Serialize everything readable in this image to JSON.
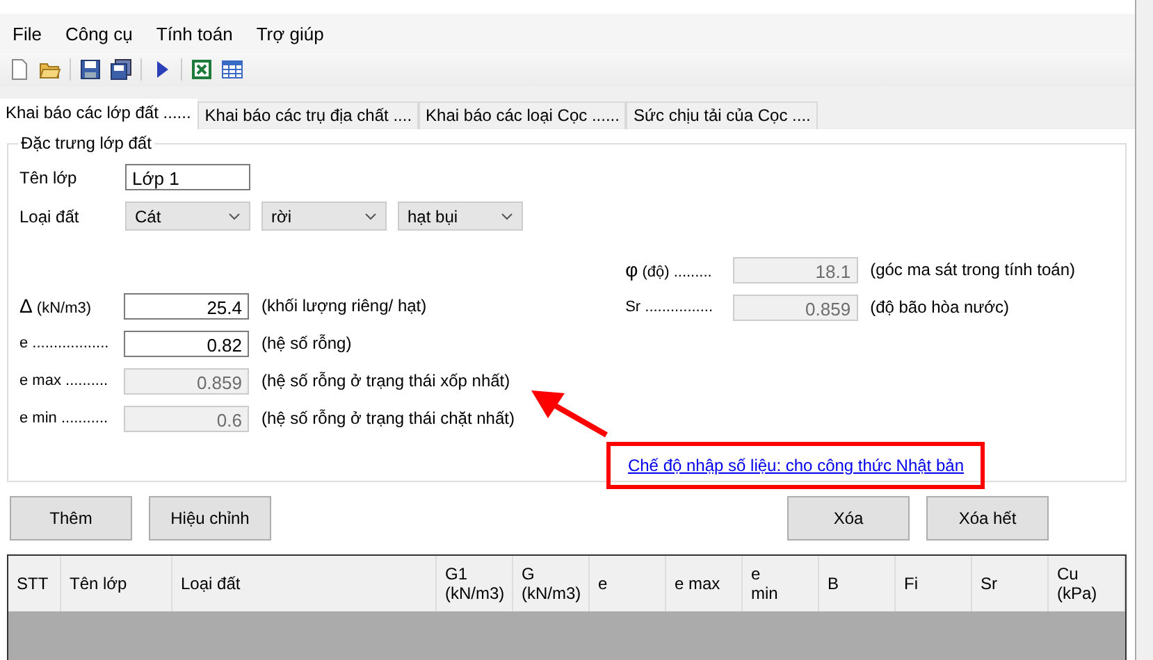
{
  "menu": [
    "File",
    "Công cụ",
    "Tính toán",
    "Trợ giúp"
  ],
  "toolbar": [
    {
      "kind": "new"
    },
    {
      "kind": "open"
    },
    {
      "kind": "sep"
    },
    {
      "kind": "save"
    },
    {
      "kind": "saveall"
    },
    {
      "kind": "sep"
    },
    {
      "kind": "run"
    },
    {
      "kind": "sep"
    },
    {
      "kind": "excel"
    },
    {
      "kind": "table"
    }
  ],
  "tabs": [
    {
      "label": "Khai báo các lớp đất ......",
      "selected": true
    },
    {
      "label": "Khai báo các trụ địa chất  ....",
      "selected": false
    },
    {
      "label": "Khai báo các loại Cọc ......",
      "selected": false
    },
    {
      "label": "Sức chịu tải của Cọc ....",
      "selected": false
    }
  ],
  "group": {
    "title": "Đặc trưng lớp đất",
    "name_label": "Tên lớp",
    "name_value": "Lớp 1",
    "type_label": "Loại đất",
    "type_combos": [
      "Cát",
      "rời",
      "hạt bụi"
    ],
    "left_params": [
      {
        "label": "Δ",
        "unit": " (kN/m3)",
        "value": "25.4",
        "note": "(khối lượng riêng/ hạt)",
        "disabled": false
      },
      {
        "label": "e ..................",
        "value": "0.82",
        "note": "(hệ số rỗng)",
        "disabled": false
      },
      {
        "label": "e max ..........",
        "value": "0.859",
        "note": "(hệ số rỗng ở trạng thái xốp nhất)",
        "disabled": true
      },
      {
        "label": "e min ...........",
        "value": "0.6",
        "note": "(hệ số rỗng ở trạng thái chặt nhất)",
        "disabled": true
      }
    ],
    "right_params": [
      {
        "label": "φ",
        "unit": " (độ) .........",
        "value": "18.1",
        "note": "(góc ma sát trong tính toán)",
        "disabled": true
      },
      {
        "label": "Sr ................",
        "value": "0.859",
        "note": "(độ bão hòa nước)",
        "disabled": true
      }
    ],
    "mode_link": "Chế độ nhập số liệu: cho công thức Nhật bản"
  },
  "buttons_left": [
    "Thêm",
    "Hiệu chỉnh"
  ],
  "buttons_right": [
    "Xóa",
    "Xóa hết"
  ],
  "table": {
    "columns": [
      "STT",
      "Tên lớp",
      "Loại đất",
      "G1\n(kN/m3)",
      "G\n(kN/m3)",
      "e",
      "e max",
      "e\nmin",
      "B",
      "Fi",
      "Sr",
      "Cu\n(kPa)"
    ]
  }
}
